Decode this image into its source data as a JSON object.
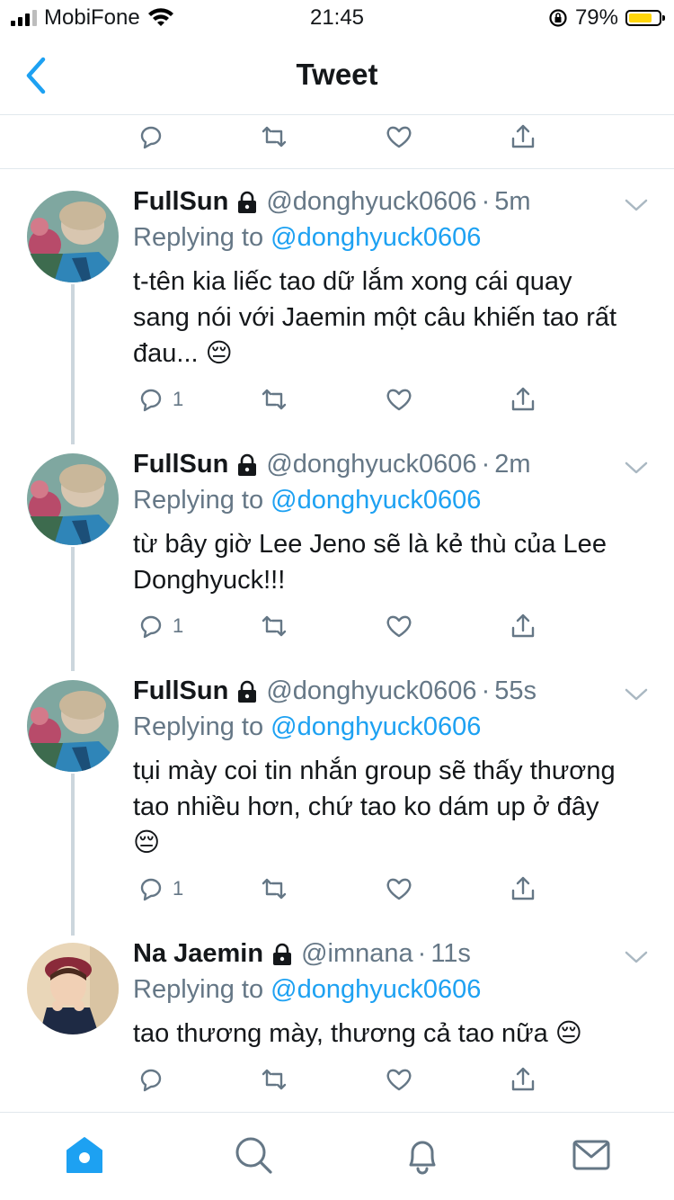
{
  "status_bar": {
    "carrier": "MobiFone",
    "time": "21:45",
    "battery": "79%",
    "battery_level": 0.79
  },
  "nav": {
    "title": "Tweet",
    "back_icon": "chevron-left-icon"
  },
  "top_actions": {
    "reply_count": "",
    "icons": [
      "reply-icon",
      "retweet-icon",
      "like-icon",
      "share-icon"
    ]
  },
  "tweets": [
    {
      "name": "FullSun",
      "protected": true,
      "handle": "@donghyuck0606",
      "time": "5m",
      "replying_prefix": "Replying to",
      "replying_to": "@donghyuck0606",
      "line1": "t-tên kia liếc tao dữ lắm xong cái quay",
      "line2": "sang nói với Jaemin một câu khiến tao rất",
      "line3": "đau... 😔",
      "reply_count": "1"
    },
    {
      "name": "FullSun",
      "protected": true,
      "handle": "@donghyuck0606",
      "time": "2m",
      "replying_prefix": "Replying to",
      "replying_to": "@donghyuck0606",
      "line1": "từ bây giờ Lee Jeno sẽ là kẻ thù của Lee",
      "line2": "Donghyuck!!!",
      "reply_count": "1"
    },
    {
      "name": "FullSun",
      "protected": true,
      "handle": "@donghyuck0606",
      "time": "55s",
      "replying_prefix": "Replying to",
      "replying_to": "@donghyuck0606",
      "line1": "tụi mày coi tin nhắn group sẽ thấy thương",
      "line2": "tao nhiều hơn, chứ tao ko dám up ở đây",
      "line3": "😔",
      "reply_count": "1"
    },
    {
      "name": "Na Jaemin",
      "protected": true,
      "handle": "@imnana",
      "time": "11s",
      "replying_prefix": "Replying to",
      "replying_to": "@donghyuck0606",
      "line1": "tao thương mày, thương cả tao nữa 😔",
      "reply_count": ""
    }
  ],
  "separator": "·",
  "tab_bar": {
    "tabs": [
      "home-icon",
      "search-icon",
      "notifications-icon",
      "messages-icon"
    ],
    "active": "home-icon"
  },
  "colors": {
    "accent": "#1da1f2",
    "secondary_text": "#657786",
    "divider": "#e1e8ed"
  }
}
